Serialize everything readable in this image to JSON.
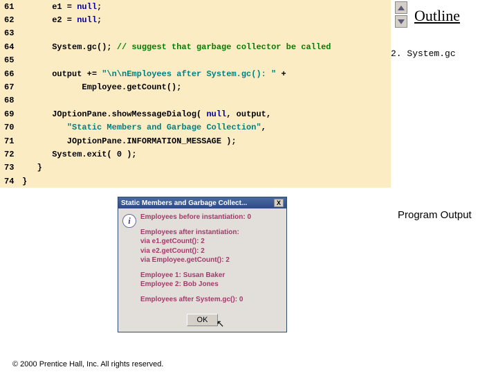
{
  "outline": {
    "label": "Outline"
  },
  "annotation": {
    "text": "2. System.gc"
  },
  "programOutput": {
    "label": "Program Output"
  },
  "footer": {
    "text": "© 2000 Prentice Hall, Inc. All rights reserved."
  },
  "dialog": {
    "title": "Static Members and Garbage Collect...",
    "closeGlyph": "X",
    "infoGlyph": "i",
    "lines": {
      "l1": "Employees before instantiation: 0",
      "l2a": "Employees after instantiation:",
      "l2b": "via e1.getCount(): 2",
      "l2c": "via e2.getCount(): 2",
      "l2d": "via Employee.getCount(): 2",
      "l3a": "Employee 1: Susan Baker",
      "l3b": "Employee 2: Bob Jones",
      "l4": "Employees after System.gc(): 0"
    },
    "ok": "OK"
  },
  "code": {
    "r61": {
      "n": "61",
      "a": "      e1 = ",
      "kw": "null",
      "b": ";"
    },
    "r62": {
      "n": "62",
      "a": "      e2 = ",
      "kw": "null",
      "b": ";"
    },
    "r63": {
      "n": "63"
    },
    "r64": {
      "n": "64",
      "a": "      System.gc(); ",
      "cm": "// suggest that garbage collector be called"
    },
    "r65": {
      "n": "65"
    },
    "r66": {
      "n": "66",
      "a": "      output += ",
      "str": "\"\\n\\nEmployees after System.gc(): \"",
      "b": " +"
    },
    "r67": {
      "n": "67",
      "a": "            Employee.getCount();"
    },
    "r68": {
      "n": "68"
    },
    "r69": {
      "n": "69",
      "a": "      JOptionPane.showMessageDialog( ",
      "kw": "null",
      "b": ", output,"
    },
    "r70": {
      "n": "70",
      "a": "         ",
      "str": "\"Static Members and Garbage Collection\"",
      "b": ","
    },
    "r71": {
      "n": "71",
      "a": "         JOptionPane.INFORMATION_MESSAGE );"
    },
    "r72": {
      "n": "72",
      "a": "      System.exit( ",
      "num": "0",
      "b": " );"
    },
    "r73": {
      "n": "73",
      "a": "   }"
    },
    "r74": {
      "n": "74",
      "a": "}"
    }
  }
}
